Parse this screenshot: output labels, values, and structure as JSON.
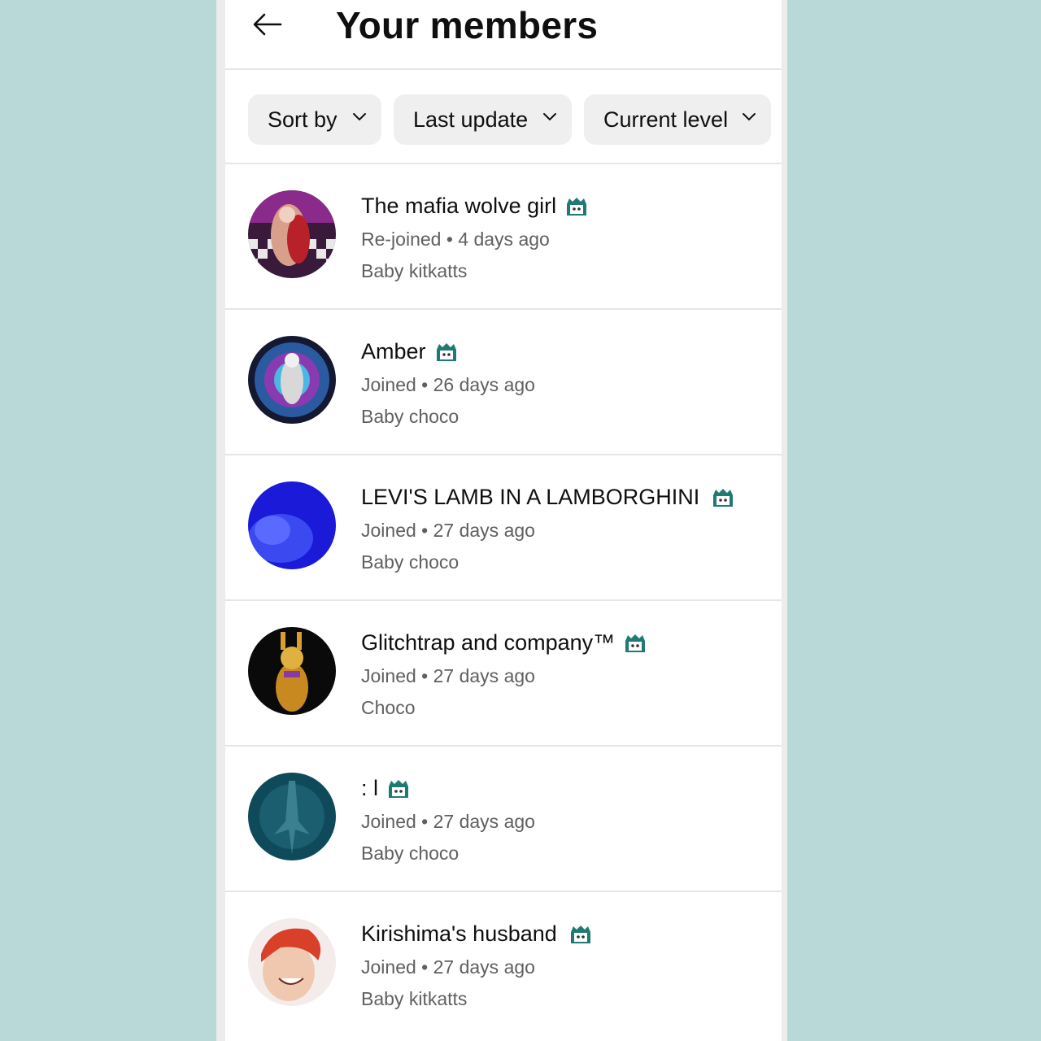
{
  "header": {
    "title": "Your members"
  },
  "filters": [
    {
      "label": "Sort by"
    },
    {
      "label": "Last update"
    },
    {
      "label": "Current level"
    }
  ],
  "members": [
    {
      "name": "The mafia wolve girl",
      "status": "Re-joined",
      "time": "4 days ago",
      "level": "Baby kitkatts"
    },
    {
      "name": "Amber",
      "status": "Joined",
      "time": "26 days ago",
      "level": "Baby choco"
    },
    {
      "name": "LEVI'S LAMB IN A LAMBORGHINI ",
      "status": "Joined",
      "time": "27 days ago",
      "level": "Baby choco"
    },
    {
      "name": "Glitchtrap and company™",
      "status": "Joined",
      "time": "27 days ago",
      "level": "Choco"
    },
    {
      "name": ": l",
      "status": "Joined",
      "time": "27 days ago",
      "level": "Baby choco"
    },
    {
      "name": "Kirishima's husband ",
      "status": "Joined",
      "time": "27 days ago",
      "level": "Baby kitkatts"
    }
  ],
  "separator": "•",
  "icons": {
    "back": "arrow-left-icon",
    "chevron": "chevron-down-icon",
    "badge": "member-badge-icon"
  },
  "colors": {
    "background": "#b9d9d8",
    "chip": "#efefef",
    "secondary_text": "#606060",
    "badge": "#1f7a73"
  }
}
